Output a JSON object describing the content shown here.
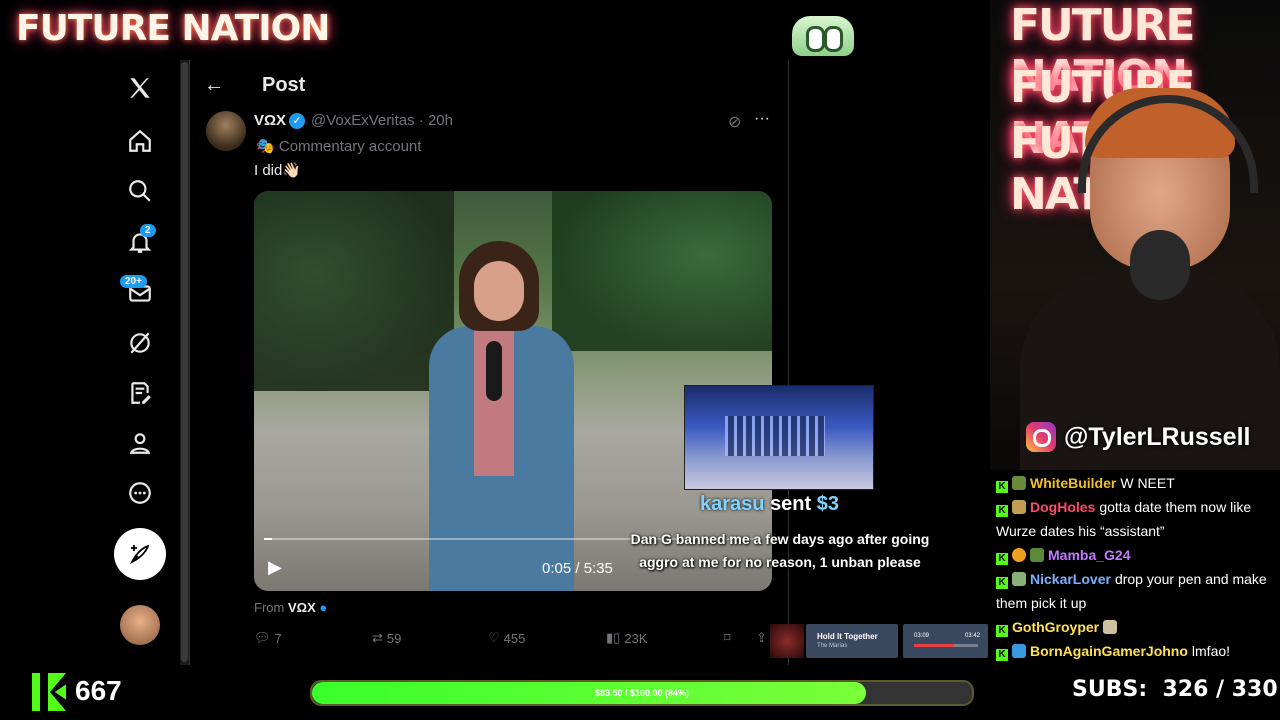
{
  "brand": {
    "title": "FUTURE NATION"
  },
  "x": {
    "header": {
      "title": "Post"
    },
    "nav": {
      "notifications_badge": "2",
      "messages_badge": "20+"
    },
    "post": {
      "author_name": "VΩX",
      "handle_time": "@VoxExVeritas · 20h",
      "label": "Commentary account",
      "text": "I did👋🏻",
      "video_time": "0:05 / 5:35",
      "from_prefix": "From",
      "from_name": "VΩX",
      "replies": "7",
      "reposts": "59",
      "likes": "455",
      "views": "23K"
    }
  },
  "alert": {
    "username": "karasu",
    "sent": "sent",
    "amount": "$3",
    "message": "Dan G banned me a few days ago after going aggro at me for no reason, 1 unban please"
  },
  "music": {
    "title": "Hold It Together",
    "artist": "The Marías",
    "elapsed": "03:09",
    "total": "03:42",
    "progress": 0.62
  },
  "cam": {
    "overlay_text": "FUTURE NATION",
    "instagram": "@TylerLRussell"
  },
  "chat": [
    {
      "user": "WhiteBuilder",
      "color": "#f0c020",
      "msg": "W NEET"
    },
    {
      "user": "DogHoles",
      "color": "#ff4a6a",
      "msg": "gotta date them now like Wurze dates his “assistant”"
    },
    {
      "user": "Mamba_G24",
      "color": "#c07aff",
      "msg": ""
    },
    {
      "user": "NickarLover",
      "color": "#7ab0ff",
      "msg": "drop your pen and make them pick it up"
    },
    {
      "user": "GothGroyper",
      "color": "#ffe050",
      "msg": ""
    },
    {
      "user": "BornAgainGamerJohno",
      "color": "#ffe050",
      "msg": "lmfao!"
    }
  ],
  "bottom": {
    "kick_count": "667",
    "goal_text": "$83.50 / $100.00 (84%)",
    "goal_fraction": 0.84,
    "subs_label": "SUBS:",
    "subs_value": "326 / 330"
  },
  "colors": {
    "accent": "#1d9bf0",
    "kick_green": "#53fc18"
  }
}
